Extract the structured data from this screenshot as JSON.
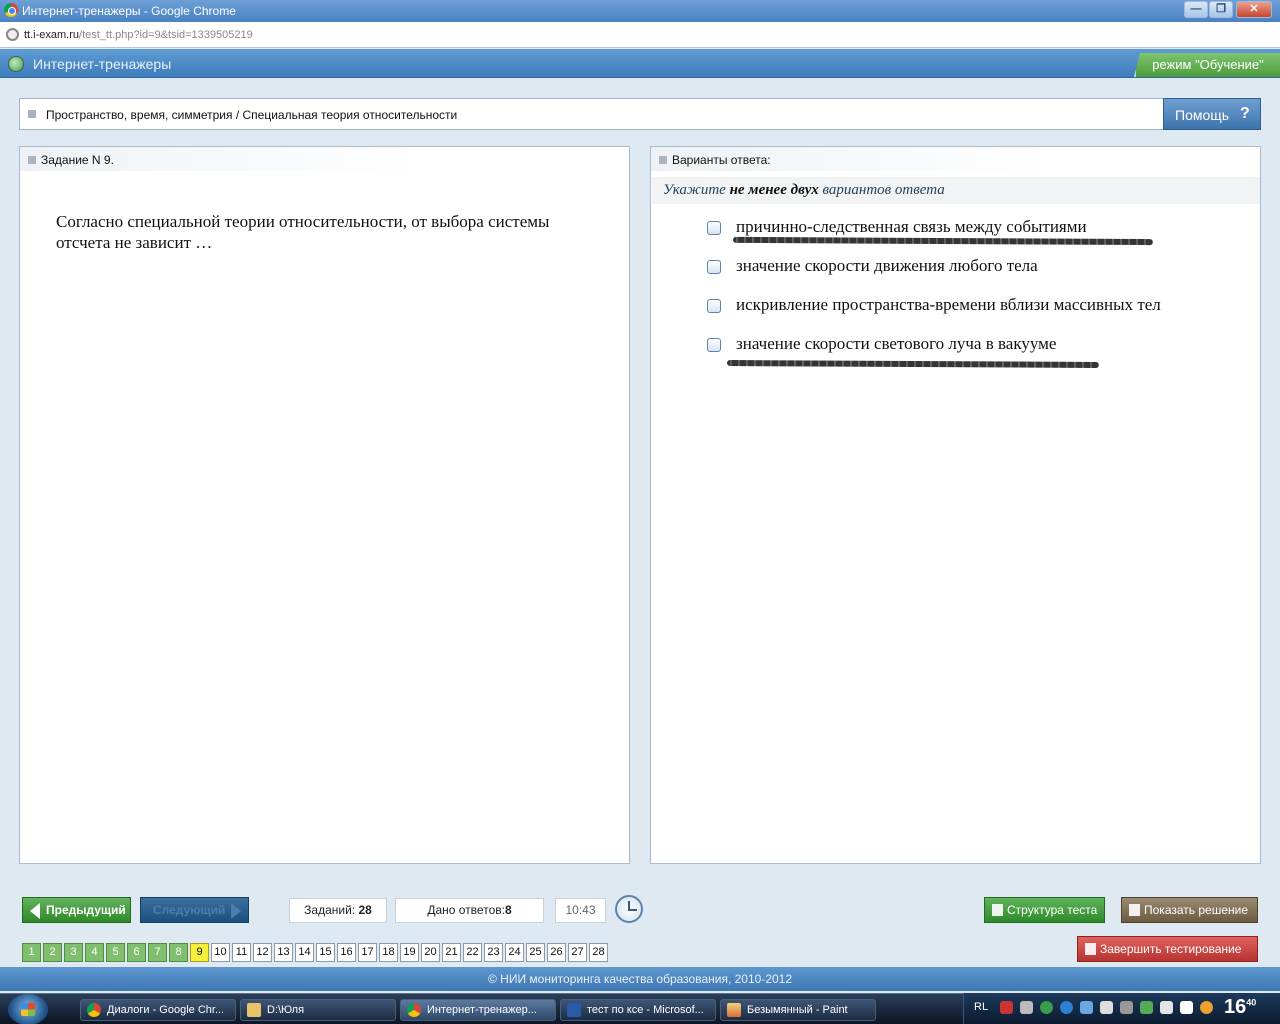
{
  "window": {
    "title": "Интернет-тренажеры - Google Chrome",
    "min": "—",
    "max": "❐",
    "close": "✕"
  },
  "address": {
    "host": "tt.i-exam.ru",
    "path": "/test_tt.php?id=9&tsid=1339505219"
  },
  "site": {
    "name": "Интернет-тренажеры",
    "mode": "режим \"Обучение\""
  },
  "breadcrumb": "Пространство, время, симметрия / Специальная теория относительности",
  "help": {
    "label": "Помощь",
    "icon": "?"
  },
  "task": {
    "header": "Задание N 9.",
    "question": "Согласно специальной теории относительности, от выбора системы отсчета не зависит …"
  },
  "answers": {
    "header": "Варианты ответа:",
    "instruction_pre": "Укажите ",
    "instruction_bold": "не менее двух",
    "instruction_post": " вариантов ответа",
    "options": [
      "причинно-следственная связь между событиями",
      "значение скорости движения любого тела",
      "искривление пространства-времени вблизи массивных тел",
      "значение скорости светового луча в вакууме"
    ]
  },
  "nav": {
    "prev": "Предыдущий",
    "next": "Следующий",
    "tasks_label": "Заданий: ",
    "tasks_count": "28",
    "answers_label": "Дано ответов:",
    "answers_count": "8",
    "timer": "10:43",
    "structure": "Структура теста",
    "show_solution": "Показать решение",
    "finish": "Завершить тестирование"
  },
  "pages": [
    "1",
    "2",
    "3",
    "4",
    "5",
    "6",
    "7",
    "8",
    "9",
    "10",
    "11",
    "12",
    "13",
    "14",
    "15",
    "16",
    "17",
    "18",
    "19",
    "20",
    "21",
    "22",
    "23",
    "24",
    "25",
    "26",
    "27",
    "28"
  ],
  "current_page": "9",
  "footer": "© НИИ мониторинга качества образования, 2010-2012",
  "taskbar": {
    "items": [
      "Диалоги - Google Chr...",
      "D:\\Юля",
      "Интернет-тренажер...",
      "тест по ксе - Microsof...",
      "Безымянный - Paint"
    ],
    "lang": "RL",
    "time_h": "16",
    "time_m": "40"
  },
  "colors": {
    "done": "#7fbf6e",
    "current": "#f5ef3c",
    "header": "#4a86c5"
  }
}
